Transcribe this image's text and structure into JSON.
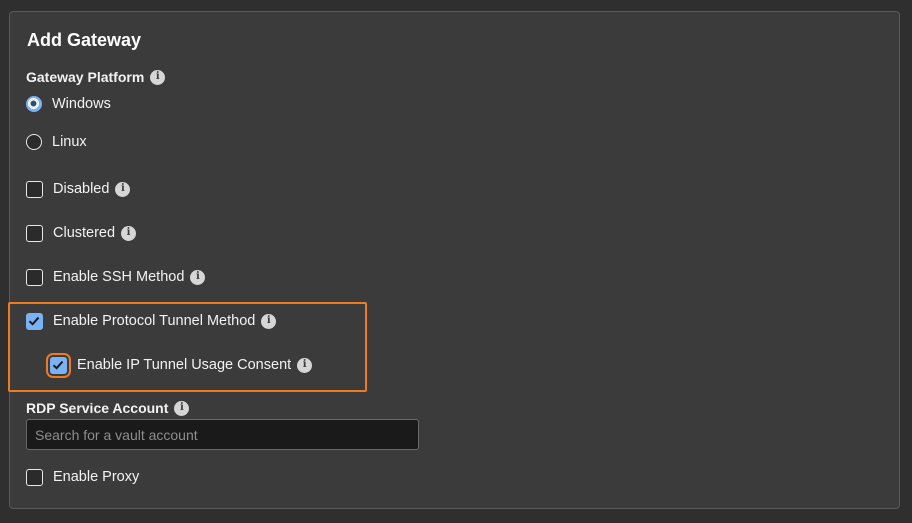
{
  "form": {
    "title": "Add Gateway",
    "platform": {
      "label": "Gateway Platform",
      "options": [
        {
          "label": "Windows",
          "selected": true
        },
        {
          "label": "Linux",
          "selected": false
        }
      ]
    },
    "checkboxes": {
      "disabled": {
        "label": "Disabled",
        "checked": false
      },
      "clustered": {
        "label": "Clustered",
        "checked": false
      },
      "ssh": {
        "label": "Enable SSH Method",
        "checked": false
      },
      "protocol_tunnel": {
        "label": "Enable Protocol Tunnel Method",
        "checked": true
      },
      "ip_tunnel_consent": {
        "label": "Enable IP Tunnel Usage Consent",
        "checked": true
      },
      "proxy": {
        "label": "Enable Proxy",
        "checked": false
      }
    },
    "rdp": {
      "label": "RDP Service Account",
      "placeholder": "Search for a vault account",
      "value": ""
    }
  },
  "colors": {
    "accent": "#7ab3f5",
    "highlight": "#f07a1e",
    "panel": "#3b3b3b"
  }
}
